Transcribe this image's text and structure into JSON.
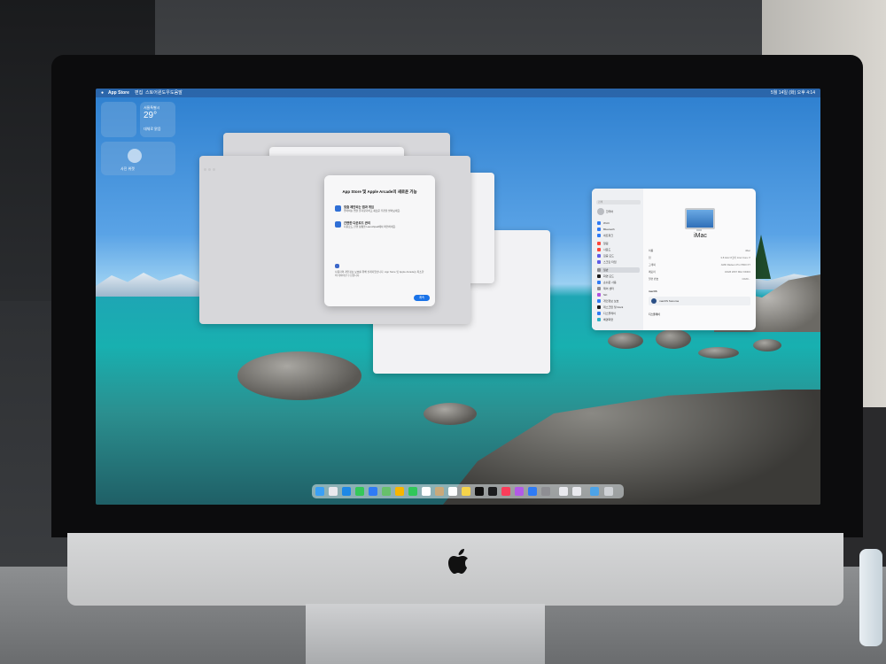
{
  "menubar": {
    "apple": "",
    "app_name": "App Store",
    "menus": [
      "편집",
      "스토어",
      "윈도우",
      "도움말"
    ],
    "status": "5월 14일 (화) 오후 4:14"
  },
  "widgets": {
    "weather_city": "서울특별시",
    "weather_temp": "29°",
    "weather_note": "대체로 맑음",
    "photo_widget": "사진 위젯"
  },
  "dialog": {
    "title": "App Store 및 Apple Arcade의 새로운 기능",
    "features": [
      {
        "title": "맞춤 제안되는 앱과 게임",
        "desc": "좋아하는 앱을 즐겨찾기하고 새로운 추천을 받아보세요."
      },
      {
        "title": "간편한 다운로드 관리",
        "desc": "다운로드 진행 상황을 Launchpad에서 확인하세요."
      }
    ],
    "body": "사용자의 개인정보 보호를 위해 설계되었습니다. App Store 및 Apple Arcade는 최소한의 데이터만 수집합니다.",
    "continue_label": "계속"
  },
  "settings_window": {
    "search_placeholder": "검색",
    "user_label": "한국어",
    "sidebar_items": [
      "Wi-Fi",
      "Bluetooth",
      "네트워크",
      "알림",
      "사운드",
      "집중 모드",
      "스크린 타임",
      "일반",
      "화면 모드",
      "손쉬운 사용",
      "제어 센터",
      "Siri",
      "개인정보 보호",
      "데스크탑 및 Dock",
      "디스플레이",
      "배경화면"
    ],
    "model": "iMac",
    "specs": [
      {
        "label": "이름",
        "value": "iMac"
      },
      {
        "label": "칩",
        "value": "3.8 GHz 8코어 Intel Core i7"
      },
      {
        "label": "그래픽",
        "value": "AMD Radeon Pro 5500 XT"
      },
      {
        "label": "메모리",
        "value": "32GB 2667 MHz DDR4"
      },
      {
        "label": "일련 번호",
        "value": "C02D..."
      }
    ],
    "macos_label": "macOS",
    "macos_name": "macOS Sonoma",
    "display_label": "디스플레이"
  },
  "dock": {
    "items": [
      "finder-icon",
      "launchpad-icon",
      "safari-icon",
      "messages-icon",
      "mail-icon",
      "maps-icon",
      "photos-icon",
      "facetime-icon",
      "calendar-icon",
      "contacts-icon",
      "reminders-icon",
      "notes-icon",
      "music-icon",
      "podcasts-icon",
      "tv-icon",
      "news-icon",
      "keynote-icon",
      "appstore-icon",
      "settings-icon",
      "preview-icon",
      "downloads-icon",
      "trash-icon"
    ]
  },
  "colors": {
    "dock_blue": "#1a73e8",
    "accent": "#1a73e8"
  }
}
